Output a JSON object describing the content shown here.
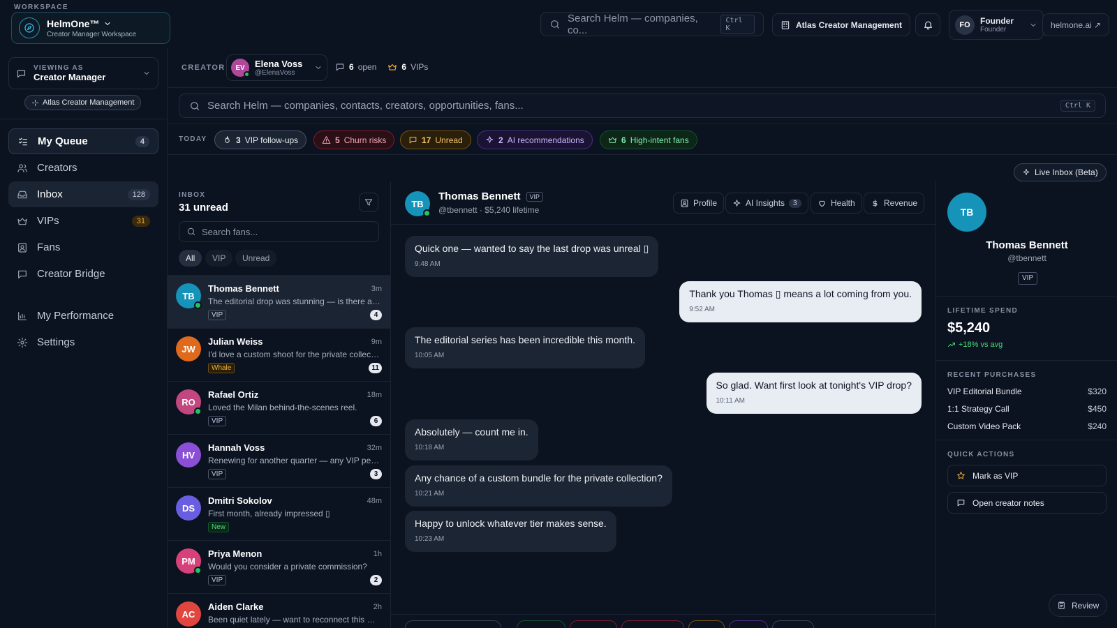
{
  "workspace": {
    "label": "WORKSPACE",
    "name": "HelmOne™",
    "subtitle": "Creator Manager Workspace"
  },
  "topbar": {
    "search_placeholder": "Search Helm — companies, co...",
    "search_shortcut": "Ctrl K",
    "org_button": "Atlas Creator Management",
    "user": {
      "initials": "FO",
      "name": "Founder",
      "role": "Founder"
    },
    "link": "helmone.ai ↗"
  },
  "sidebar": {
    "viewing_label": "VIEWING AS",
    "viewing_value": "Creator Manager",
    "org_pill": "Atlas Creator Management",
    "items": [
      {
        "label": "My Queue",
        "count": "4"
      },
      {
        "label": "Creators"
      },
      {
        "label": "Inbox",
        "count": "128"
      },
      {
        "label": "VIPs",
        "count": "31"
      },
      {
        "label": "Fans"
      },
      {
        "label": "Creator Bridge"
      },
      {
        "label": "My Performance"
      },
      {
        "label": "Settings"
      }
    ]
  },
  "creator": {
    "label": "CREATOR",
    "initials": "EV",
    "name": "Elena Voss",
    "handle": "@ElenaVoss",
    "open_count": "6",
    "open_label": "open",
    "vip_count": "6",
    "vip_label": "VIPs"
  },
  "main_search": {
    "placeholder": "Search Helm — companies, contacts, creators, opportunities, fans...",
    "shortcut": "Ctrl K"
  },
  "today": {
    "label": "TODAY",
    "pills": [
      {
        "count": "3",
        "label": "VIP follow-ups"
      },
      {
        "count": "5",
        "label": "Churn risks"
      },
      {
        "count": "17",
        "label": "Unread"
      },
      {
        "count": "2",
        "label": "AI recommendations"
      },
      {
        "count": "6",
        "label": "High-intent fans"
      }
    ]
  },
  "live_inbox": "Live Inbox (Beta)",
  "inbox": {
    "label": "INBOX",
    "title": "31 unread",
    "search_placeholder": "Search fans...",
    "filters": [
      "All",
      "VIP",
      "Unread"
    ],
    "fans": [
      {
        "initials": "TB",
        "name": "Thomas Bennett",
        "time": "3m",
        "preview": "The editorial drop was stunning — is there a new series coming?",
        "tag": "VIP",
        "unread": "4",
        "color": "#1593b8"
      },
      {
        "initials": "JW",
        "name": "Julian Weiss",
        "time": "9m",
        "preview": "I'd love a custom shoot for the private collection",
        "tag": "Whale",
        "unread": "11",
        "color": "#e06a1b"
      },
      {
        "initials": "RO",
        "name": "Rafael Ortiz",
        "time": "18m",
        "preview": "Loved the Milan behind-the-scenes reel.",
        "tag": "VIP",
        "unread": "6",
        "color": "#c2477f"
      },
      {
        "initials": "HV",
        "name": "Hannah Voss",
        "time": "32m",
        "preview": "Renewing for another quarter — any VIP perks coming?",
        "tag": "VIP",
        "unread": "3",
        "color": "#8a4fd6"
      },
      {
        "initials": "DS",
        "name": "Dmitri Sokolov",
        "time": "48m",
        "preview": "First month, already impressed ▯",
        "tag": "New",
        "unread": "",
        "color": "#6a5ee0"
      },
      {
        "initials": "PM",
        "name": "Priya Menon",
        "time": "1h",
        "preview": "Would you consider a private commission?",
        "tag": "VIP",
        "unread": "2",
        "color": "#d6417a"
      },
      {
        "initials": "AC",
        "name": "Aiden Clarke",
        "time": "2h",
        "preview": "Been quiet lately — want to reconnect this week",
        "tag": "",
        "unread": "",
        "color": "#e0463f"
      }
    ]
  },
  "chat": {
    "initials": "TB",
    "name": "Thomas Bennett",
    "vip": "VIP",
    "meta": "@tbennett · $5,240 lifetime",
    "buttons": [
      "Profile",
      "AI Insights",
      "Health",
      "Revenue"
    ],
    "ai_count": "3",
    "messages": [
      {
        "dir": "in",
        "text": "Quick one — wanted to say the last drop was unreal ▯",
        "time": "9:48 AM"
      },
      {
        "dir": "out",
        "text": "Thank you Thomas ▯ means a lot coming from you.",
        "time": "9:52 AM"
      },
      {
        "dir": "in",
        "text": "The editorial series has been incredible this month.",
        "time": "10:05 AM"
      },
      {
        "dir": "out",
        "text": "So glad. Want first look at tonight's VIP drop?",
        "time": "10:11 AM"
      },
      {
        "dir": "in",
        "text": "Absolutely — count me in.",
        "time": "10:18 AM"
      },
      {
        "dir": "in",
        "text": "Any chance of a custom bundle for the private collection?",
        "time": "10:21 AM"
      },
      {
        "dir": "in",
        "text": "Happy to unlock whatever tier makes sense.",
        "time": "10:23 AM"
      }
    ]
  },
  "profile": {
    "initials": "TB",
    "name": "Thomas Bennett",
    "handle": "@tbennett",
    "vip": "VIP",
    "spend_label": "LIFETIME SPEND",
    "spend": "$5,240",
    "trend": "+18% vs avg",
    "purchases_label": "RECENT PURCHASES",
    "purchases": [
      {
        "name": "VIP Editorial Bundle",
        "price": "$320"
      },
      {
        "name": "1:1 Strategy Call",
        "price": "$450"
      },
      {
        "name": "Custom Video Pack",
        "price": "$240"
      }
    ],
    "actions_label": "QUICK ACTIONS",
    "actions": [
      "Mark as VIP",
      "Open creator notes"
    ],
    "review": "Review"
  }
}
